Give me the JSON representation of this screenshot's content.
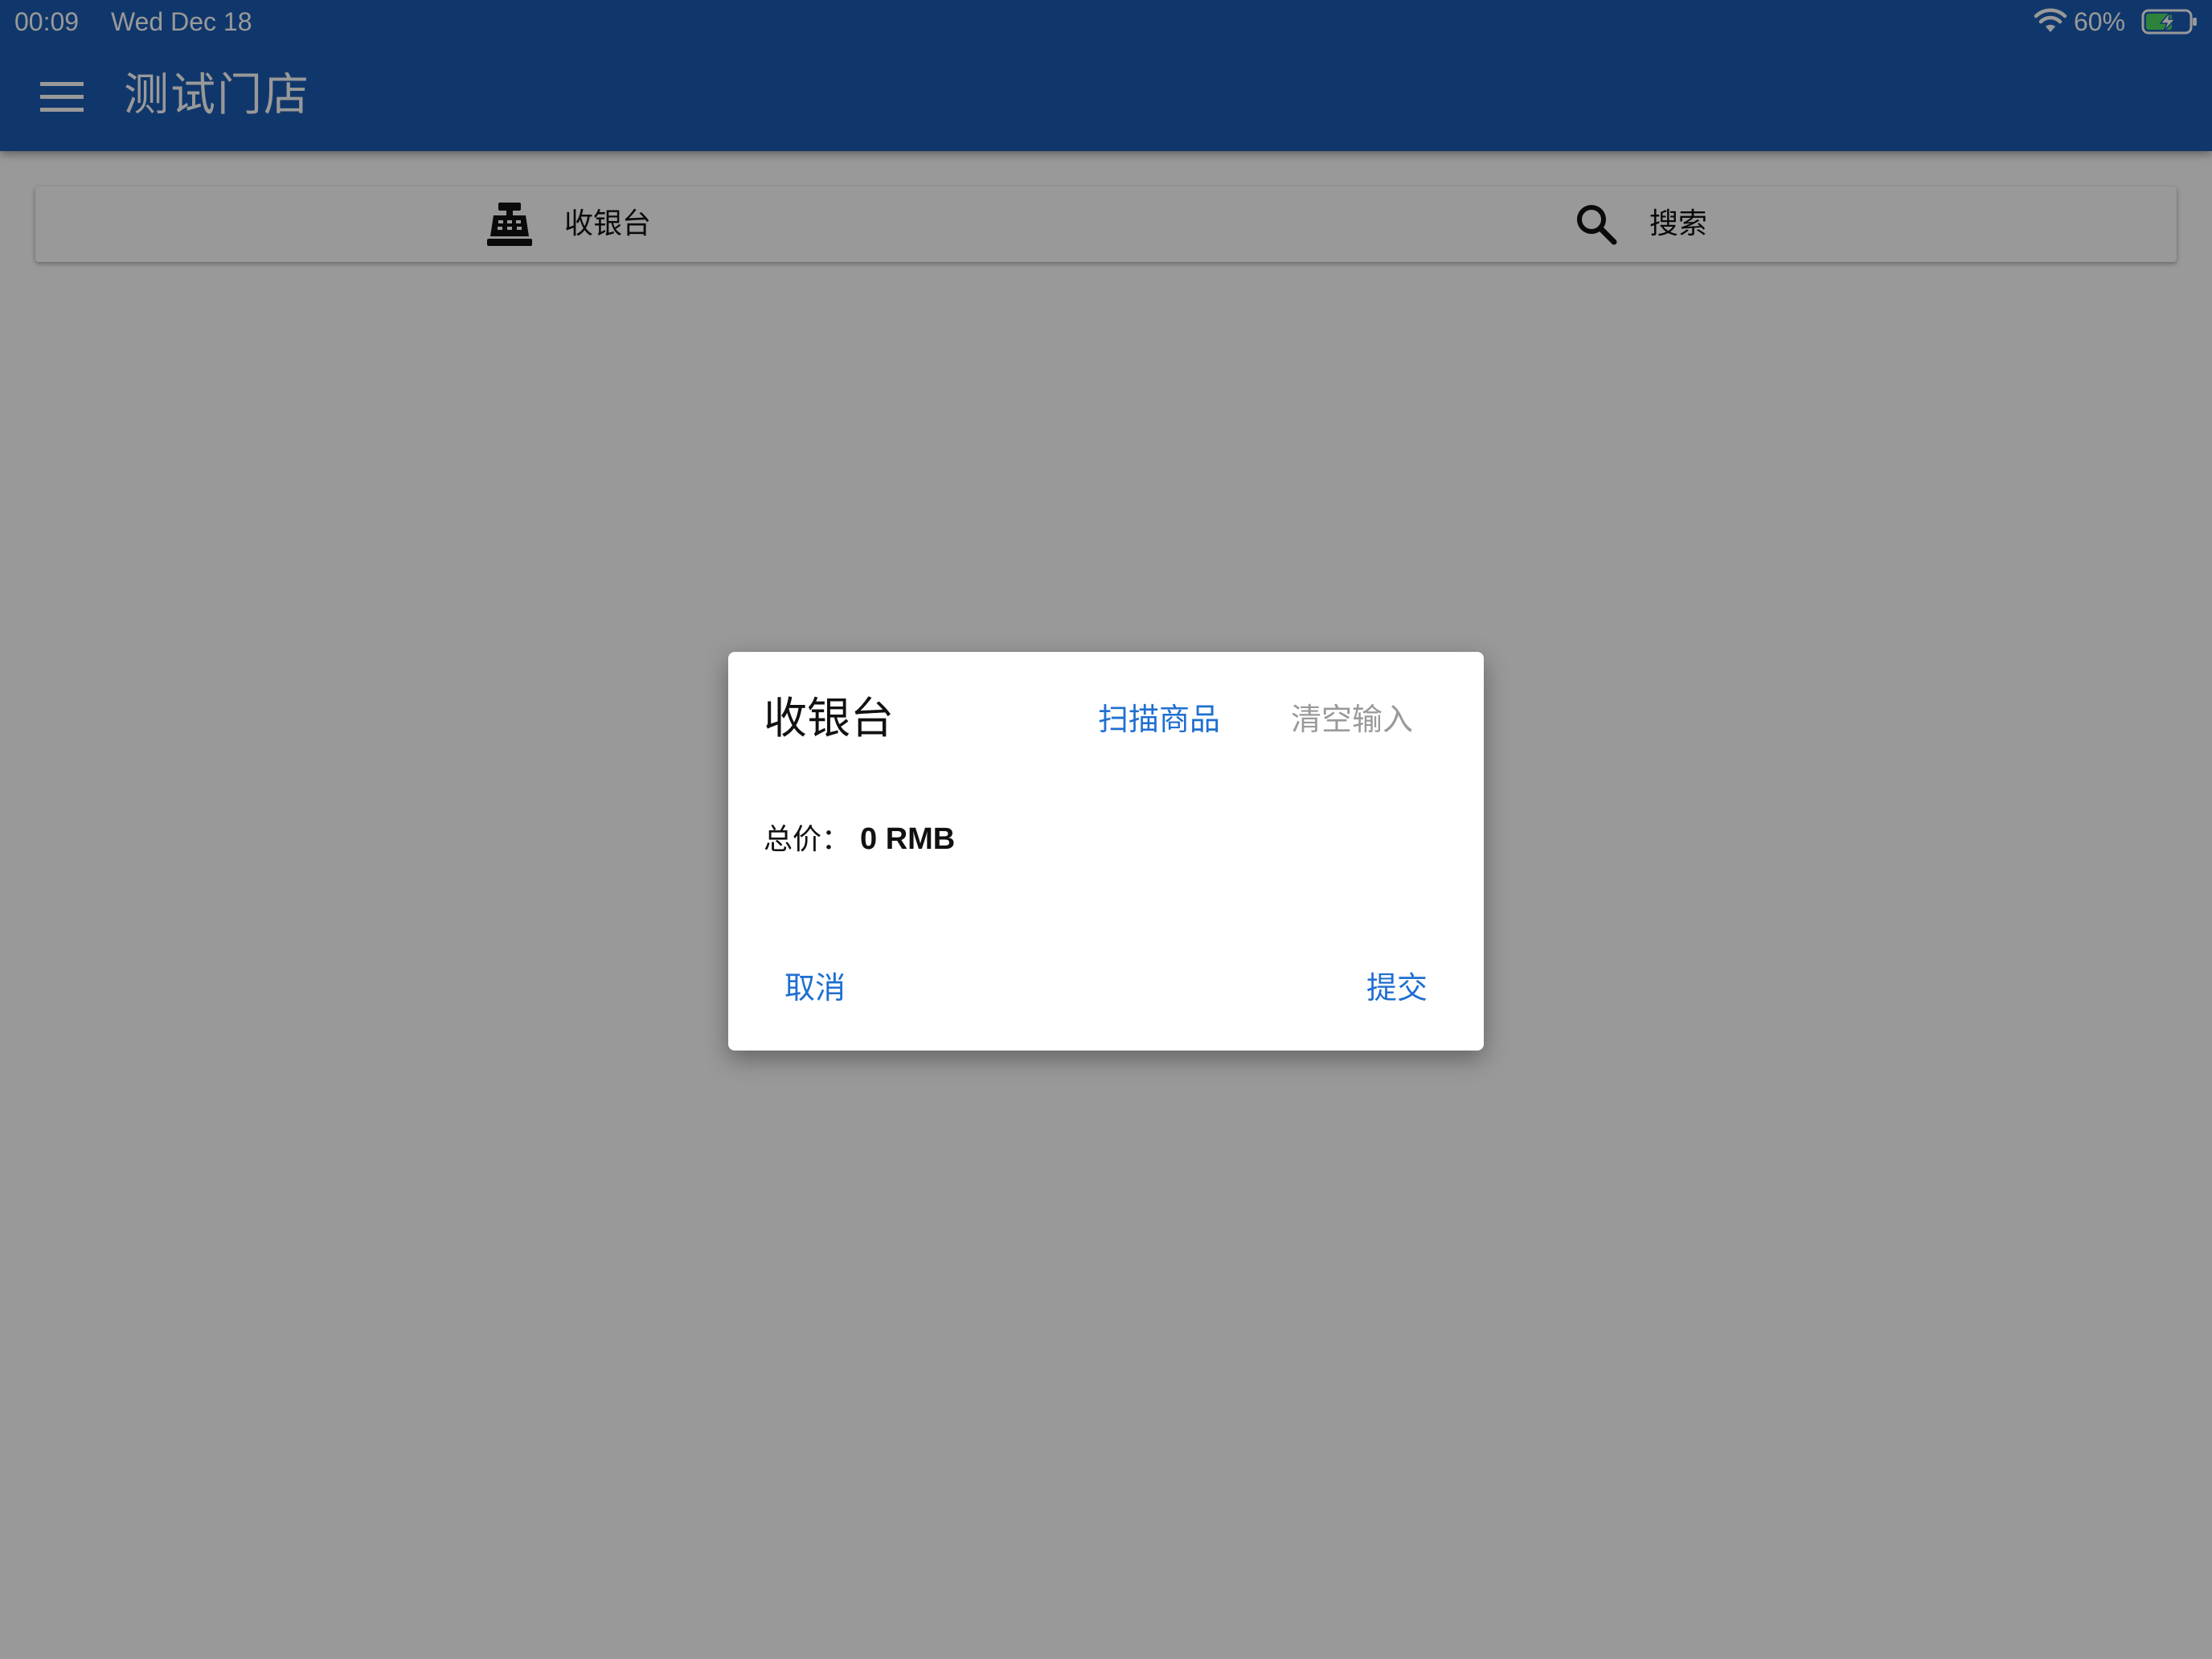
{
  "status_bar": {
    "time": "00:09",
    "date": "Wed Dec 18",
    "battery_percent": "60%",
    "icons": [
      "wifi-icon",
      "battery-charging-icon"
    ]
  },
  "app_bar": {
    "title": "测试门店",
    "menu_icon": "menu-icon",
    "background_color": "#1c5db3"
  },
  "tabs": [
    {
      "label": "收银台",
      "icon": "cash-register-icon"
    },
    {
      "label": "搜索",
      "icon": "search-icon"
    }
  ],
  "dialog": {
    "title": "收银台",
    "scan_label": "扫描商品",
    "clear_label": "清空输入",
    "total_label": "总价：",
    "total_value": "0 RMB",
    "cancel_label": "取消",
    "submit_label": "提交",
    "accent_color": "#1f6fd1",
    "disabled_color": "#9a9a9a"
  }
}
